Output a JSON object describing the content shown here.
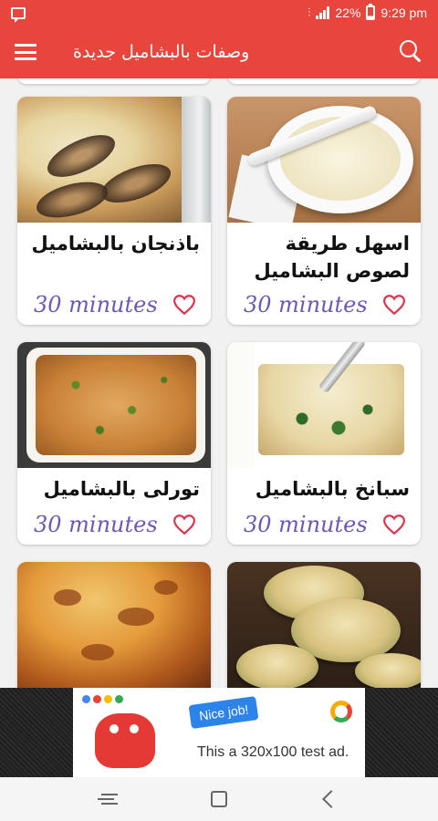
{
  "status_bar": {
    "battery": "22%",
    "time": "9:29 pm",
    "icons": [
      "message-icon",
      "vibrate-icon",
      "signal-icon",
      "battery-icon"
    ]
  },
  "app_bar": {
    "title": "وصفات بالبشاميل جديدة",
    "icons": [
      "menu-icon",
      "search-icon"
    ]
  },
  "colors": {
    "primary": "#e8453c",
    "time_label": "#6e57b5",
    "heart": "#e0314b",
    "background": "#f1f1f1"
  },
  "recipes": [
    {
      "title": "اسهل طريقة لصوص البشاميل",
      "time": "30 minutes"
    },
    {
      "title": "باذنجان بالبشاميل",
      "time": "30 minutes"
    },
    {
      "title": "سبانخ بالبشاميل",
      "time": "30 minutes"
    },
    {
      "title": "تورلى بالبشاميل",
      "time": "30 minutes"
    }
  ],
  "ad": {
    "bubble": "Nice job!",
    "text": "This a 320x100 test ad."
  },
  "nav_bar": {
    "icons": [
      "recents-icon",
      "home-icon",
      "back-icon"
    ]
  }
}
